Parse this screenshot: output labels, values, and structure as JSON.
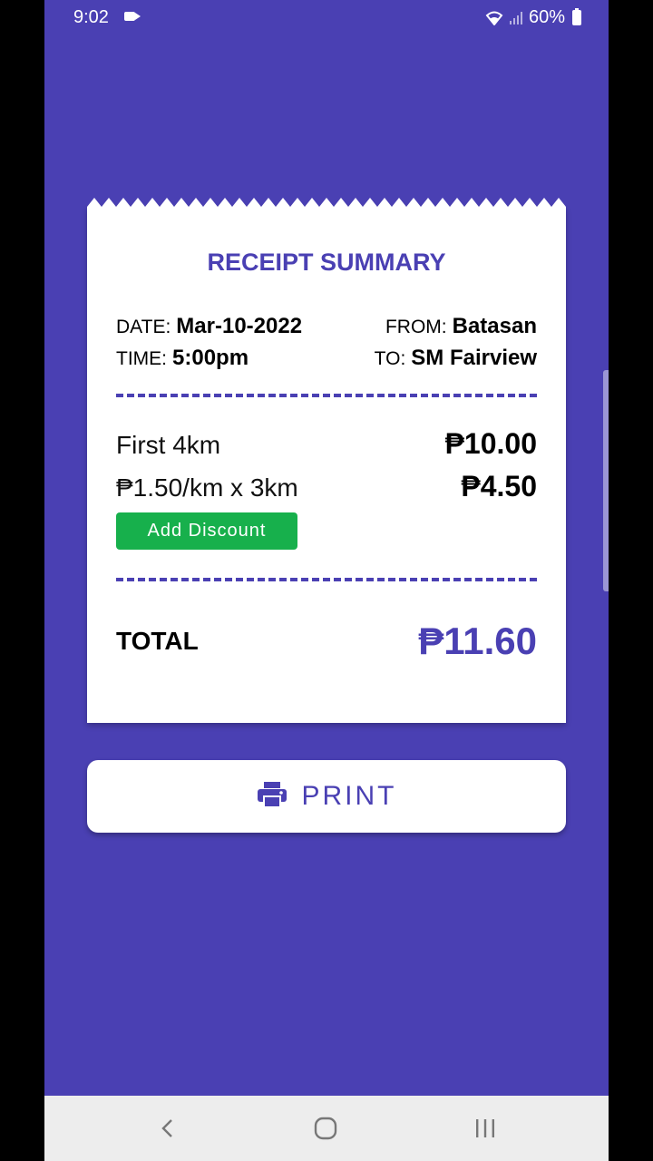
{
  "status_bar": {
    "time": "9:02",
    "battery": "60%"
  },
  "receipt": {
    "title": "RECEIPT SUMMARY",
    "date_label": "DATE:",
    "date_value": "Mar-10-2022",
    "from_label": "FROM:",
    "from_value": "Batasan",
    "time_label": "TIME:",
    "time_value": "5:00pm",
    "to_label": "TO:",
    "to_value": "SM Fairview",
    "fares": [
      {
        "description": "First 4km",
        "amount": "₱10.00"
      },
      {
        "description": "₱1.50/km x 3km",
        "amount": "₱4.50"
      }
    ],
    "discount_button": "Add Discount",
    "total_label": "TOTAL",
    "total_amount": "₱11.60"
  },
  "print_button": {
    "label": "PRINT",
    "icon": "printer-icon"
  },
  "nav_bar": {
    "back_icon": "back-icon",
    "home_icon": "home-icon",
    "recent_icon": "recent-apps-icon"
  },
  "colors": {
    "primary": "#4a40b3",
    "discount": "#17b04c",
    "surface": "#ffffff"
  }
}
